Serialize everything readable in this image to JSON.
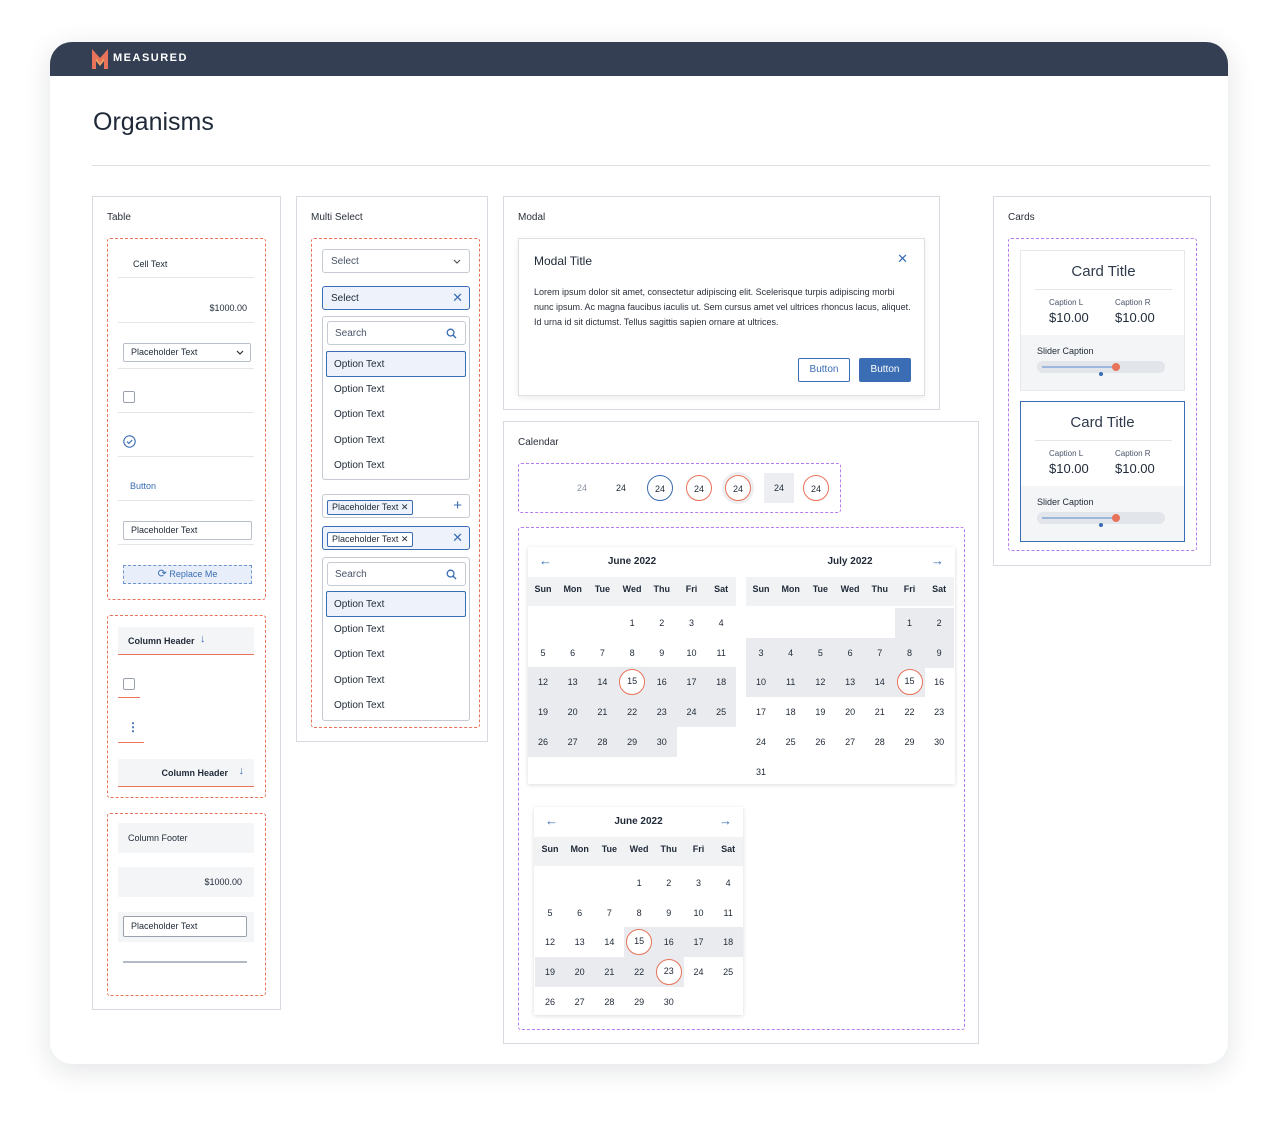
{
  "brand": {
    "name": "MEASURED",
    "accent": "#e8735a",
    "header_bg": "#353f53",
    "primary": "#3a6db3"
  },
  "page": {
    "title": "Organisms"
  },
  "table": {
    "label": "Table",
    "cell_text": "Cell Text",
    "amount": "$1000.00",
    "dropdown_placeholder": "Placeholder Text",
    "button_label": "Button",
    "input_placeholder": "Placeholder Text",
    "replace_label": "Replace Me",
    "column_header": "Column Header",
    "column_footer": "Column Footer",
    "footer_amount": "$1000.00",
    "footer_input": "Placeholder Text"
  },
  "multiselect": {
    "label": "Multi Select",
    "select_label": "Select",
    "search_placeholder": "Search",
    "options": [
      "Option Text",
      "Option Text",
      "Option Text",
      "Option Text",
      "Option Text"
    ],
    "chip_label": "Placeholder Text"
  },
  "modal": {
    "label": "Modal",
    "title": "Modal Title",
    "body": "Lorem ipsum dolor sit amet, consectetur adipiscing elit. Scelerisque turpis adipiscing morbi nunc ipsum. Ac magna faucibus iaculis ut. Sem cursus amet vel ultrices rhoncus lacus, aliquet. Id urna id sit dictumst. Tellus sagittis sapien ornare at ultrices.",
    "button_secondary": "Button",
    "button_primary": "Button"
  },
  "calendar": {
    "label": "Calendar",
    "day_variant": "24",
    "june": "June 2022",
    "july": "July 2022",
    "dows": [
      "Sun",
      "Mon",
      "Tue",
      "Wed",
      "Thu",
      "Fri",
      "Sat"
    ]
  },
  "cards": {
    "label": "Cards",
    "title": "Card Title",
    "caption_l": "Caption L",
    "caption_r": "Caption R",
    "value_l": "$10.00",
    "value_r": "$10.00",
    "slider_caption": "Slider Caption"
  }
}
